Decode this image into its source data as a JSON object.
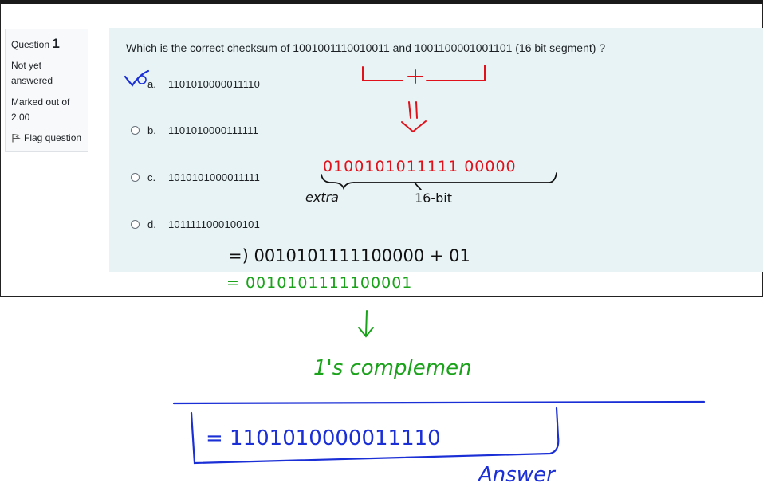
{
  "question": {
    "number_prefix": "Question",
    "number": "1",
    "state": "Not yet answered",
    "marks": "Marked out of 2.00",
    "flag_label": "Flag question",
    "text": "Which is the correct checksum of 1001001110010011 and 1001100001001101 (16 bit segment) ?"
  },
  "answers": [
    {
      "letter": "a.",
      "text": "1101010000011110"
    },
    {
      "letter": "b.",
      "text": "1101010000111111"
    },
    {
      "letter": "c.",
      "text": "1010101000011111"
    },
    {
      "letter": "d.",
      "text": "1011111000100101"
    }
  ],
  "annotations": {
    "sum_binary": "0100101011111 00000",
    "extra_label": "extra",
    "bit_label": "16-bit",
    "step_add": "=) 0010101111100000 + 01",
    "step_result": "= 0010101111100001",
    "complement_label": "1's complemen",
    "final_answer": "= 1101010000011110",
    "answer_label": "Answer",
    "colors": {
      "red": "#e0111b",
      "green": "#1aa21a",
      "blue": "#1b2fd6",
      "black": "#111111"
    }
  }
}
